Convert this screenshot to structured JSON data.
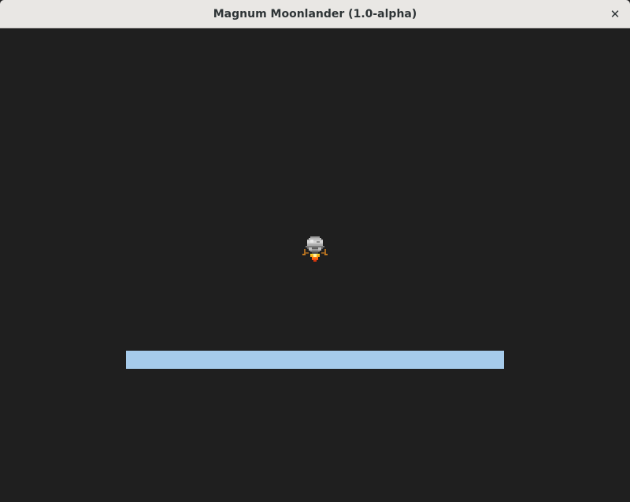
{
  "window": {
    "title": "Magnum Moonlander (1.0-alpha)",
    "close_glyph": "✕",
    "close_icon": "close-icon"
  },
  "game": {
    "background_color": "#1f1f1f",
    "lander": {
      "icon": "lunar-lander-sprite",
      "thrust_active": true
    },
    "landing_pad": {
      "color": "#a6cbeb"
    }
  }
}
